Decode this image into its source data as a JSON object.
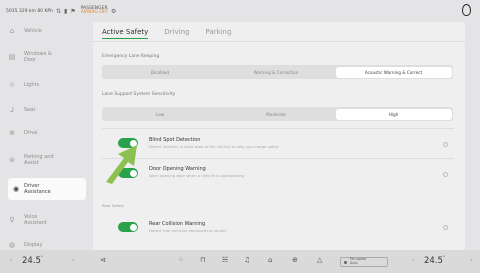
{
  "status_bar": {
    "info_text": "5035 329 km 80 KPh",
    "notice_title": "PASSENGER",
    "notice_sub": "AIRBAG OFF"
  },
  "sidebar": {
    "items": [
      {
        "label": "Vehicle",
        "icon": "car-icon"
      },
      {
        "label": "Windows & Door",
        "icon": "window-icon"
      },
      {
        "label": "Lights",
        "icon": "light-icon"
      },
      {
        "label": "Seat",
        "icon": "seat-icon"
      },
      {
        "label": "Drive",
        "icon": "steering-icon"
      },
      {
        "label": "Parking and Assist",
        "icon": "parking-assist-icon"
      },
      {
        "label": "Driver Assistance",
        "icon": "driver-assist-icon"
      },
      {
        "label": "Voice Assistant",
        "icon": "voice-icon"
      },
      {
        "label": "Display",
        "icon": "display-icon"
      }
    ]
  },
  "tabs": [
    "Active Safety",
    "Driving",
    "Parking"
  ],
  "lane_keeping": {
    "label": "Emergency Lane Keeping",
    "options": [
      "Disabled",
      "Warning & Correction",
      "Acoustic Warning & Correct"
    ],
    "selected": "Acoustic Warning & Correct"
  },
  "sensitivity": {
    "label": "Lane Support System Sensitivity",
    "options": [
      "Low",
      "Moderate",
      "High"
    ],
    "selected": "High"
  },
  "toggles": [
    {
      "title": "Blind Spot Detection",
      "subtitle": "Detect vehicles in blind area of the vehicle to help you merge safely",
      "on": true
    },
    {
      "title": "Door Opening Warning",
      "subtitle": "Warn opening door when a vehicle is approaching"
    }
  ],
  "rear_safety": {
    "label": "Rear Safety",
    "title": "Rear Collision Warning",
    "subtitle": "Detect rear vehicles approaching rapidly"
  },
  "dock": {
    "left_temp": "24.5",
    "right_temp": "24.5",
    "temp_unit": "°",
    "fan_label": "Fan speed",
    "fan_value": "Auto"
  },
  "colors": {
    "toggle_on": "#2aa24c",
    "arrow": "#8cc152",
    "tab_underline": "#2a9e4b"
  }
}
